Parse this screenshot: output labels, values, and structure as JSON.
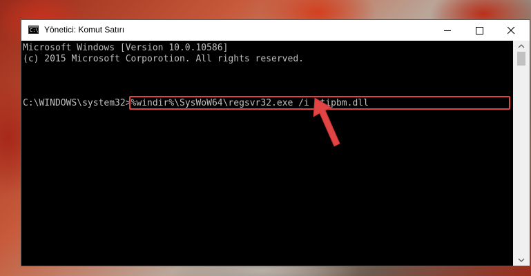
{
  "window": {
    "title": "Yönetici: Komut Satırı",
    "icon": "cmd-icon"
  },
  "console": {
    "lines": [
      "Microsoft Windows [Version 10.0.10586]",
      "(c) 2015 Microsoft Corporotion. All rights reserved."
    ],
    "prompt": "C:\\WINDOWS\\system32>",
    "command": "%windir%\\SysWoW64\\regsvr32.exe /i ptipbm.dll"
  },
  "colors": {
    "console_bg": "#000000",
    "console_text": "#c0c0c0",
    "highlight": "#e04444"
  }
}
